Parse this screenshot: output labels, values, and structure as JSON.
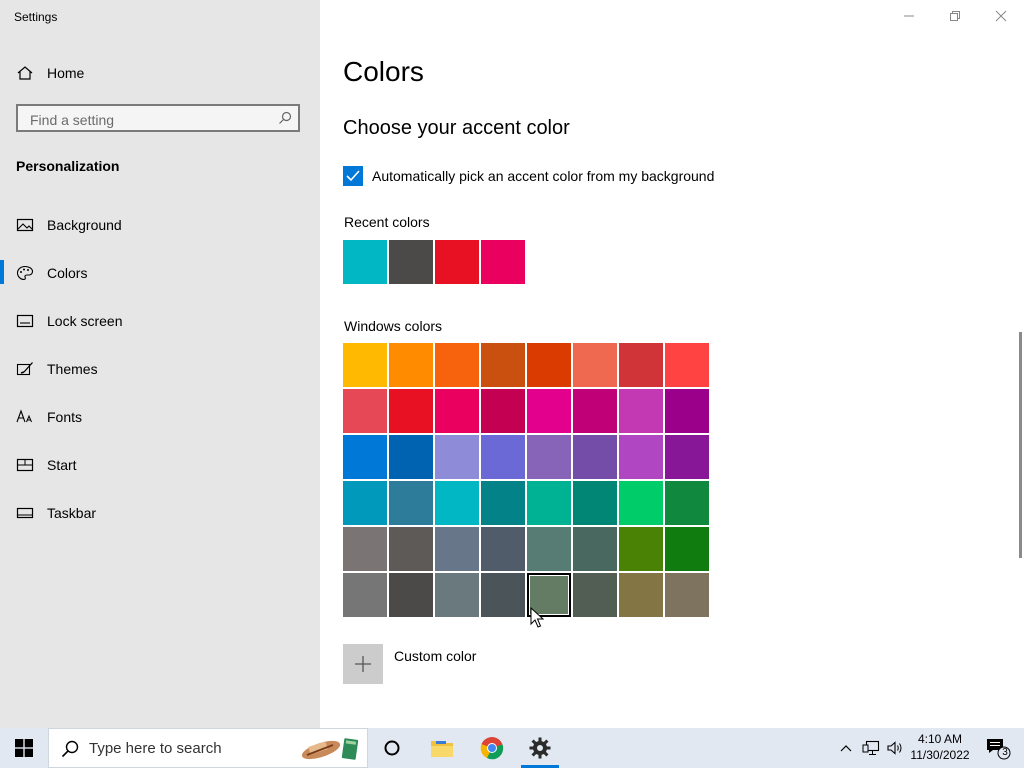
{
  "window": {
    "title": "Settings"
  },
  "sidebar": {
    "home_label": "Home",
    "search_placeholder": "Find a setting",
    "section_title": "Personalization",
    "items": [
      {
        "label": "Background",
        "icon": "picture-icon",
        "active": false
      },
      {
        "label": "Colors",
        "icon": "palette-icon",
        "active": true
      },
      {
        "label": "Lock screen",
        "icon": "lock-screen-icon",
        "active": false
      },
      {
        "label": "Themes",
        "icon": "brush-icon",
        "active": false
      },
      {
        "label": "Fonts",
        "icon": "fonts-icon",
        "active": false
      },
      {
        "label": "Start",
        "icon": "start-icon",
        "active": false
      },
      {
        "label": "Taskbar",
        "icon": "taskbar-icon",
        "active": false
      }
    ]
  },
  "main": {
    "title": "Colors",
    "subtitle": "Choose your accent color",
    "auto_pick_label": "Automatically pick an accent color from my background",
    "auto_pick_checked": true,
    "recent_label": "Recent colors",
    "recent_colors": [
      "#00b7c3",
      "#4c4a48",
      "#e81123",
      "#ea005e"
    ],
    "windows_label": "Windows colors",
    "windows_colors": [
      [
        "#ffb900",
        "#ff8c00",
        "#f7630c",
        "#ca5010",
        "#da3b01",
        "#ef6950",
        "#d13438",
        "#ff4343"
      ],
      [
        "#e74856",
        "#e81123",
        "#ea005e",
        "#c30052",
        "#e3008c",
        "#bf0077",
        "#c239b3",
        "#9a0089"
      ],
      [
        "#0078d7",
        "#0063b1",
        "#8e8cd8",
        "#6b69d6",
        "#8764b8",
        "#744da9",
        "#b146c2",
        "#881798"
      ],
      [
        "#0099bc",
        "#2d7d9a",
        "#00b7c3",
        "#038387",
        "#00b294",
        "#018574",
        "#00cc6a",
        "#10893e"
      ],
      [
        "#7a7574",
        "#5d5a58",
        "#68768a",
        "#515c6b",
        "#567c73",
        "#486860",
        "#498205",
        "#107c10"
      ],
      [
        "#767676",
        "#4c4a48",
        "#69797e",
        "#4a5459",
        "#647c64",
        "#525e54",
        "#847545",
        "#7e735f"
      ]
    ],
    "selected_color": "#647c64",
    "custom_label": "Custom color"
  },
  "taskbar": {
    "search_placeholder": "Type here to search",
    "time": "4:10 AM",
    "date": "11/30/2022",
    "notification_count": "3",
    "accent": "#0078d7"
  }
}
